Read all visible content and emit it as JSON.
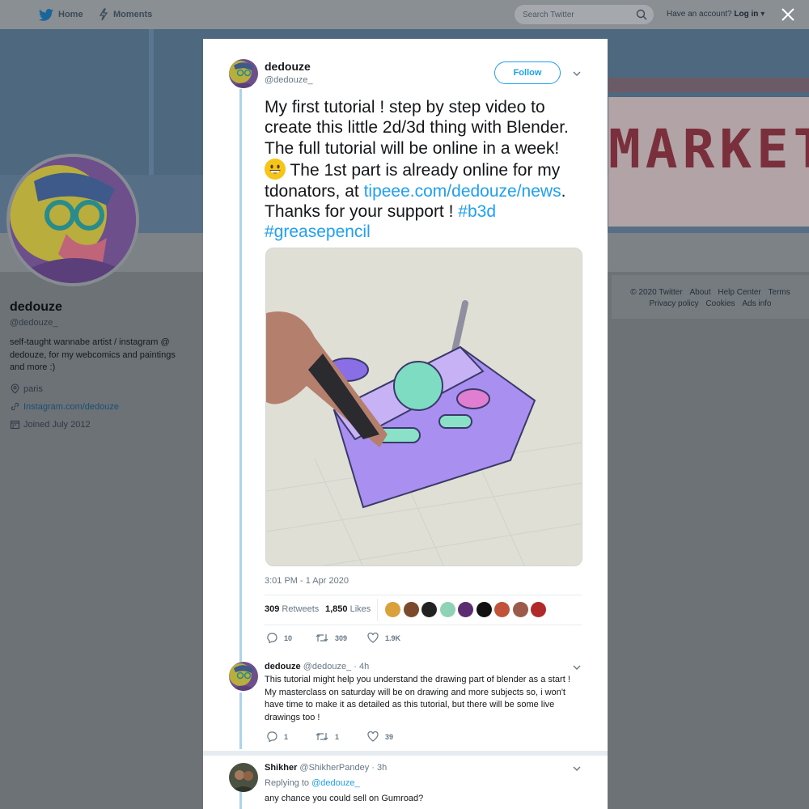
{
  "nav": {
    "home": "Home",
    "moments": "Moments",
    "search_placeholder": "Search Twitter",
    "have_account": "Have an account?",
    "login": "Log in"
  },
  "profile": {
    "name": "dedouze",
    "handle": "@dedouze_",
    "bio": "self-taught wannabe artist / instagram @ dedouze, for my webcomics and paintings and more :)",
    "location": "paris",
    "link": "Instagram.com/dedouze",
    "joined": "Joined July 2012"
  },
  "banner": {
    "sign_text": "MARKET"
  },
  "footer": {
    "copyright": "© 2020 Twitter",
    "links": [
      "About",
      "Help Center",
      "Terms",
      "Privacy policy",
      "Cookies",
      "Ads info"
    ]
  },
  "tweet": {
    "author_name": "dedouze",
    "author_handle": "@dedouze_",
    "follow_label": "Follow",
    "text_1": "My first tutorial ! step by step video to create this little 2d/3d thing with Blender. The full tutorial will be online in a week!",
    "text_2": " The 1st part is already online for my tdonators, at ",
    "link": "tipeee.com/dedouze/news",
    "text_3": ". Thanks for your support ! ",
    "hashtag_1": "#b3d",
    "hashtag_2": "#greasepencil",
    "timestamp": "3:01 PM - 1 Apr 2020",
    "retweets_count": "309",
    "retweets_label": "Retweets",
    "likes_count": "1,850",
    "likes_label": "Likes",
    "reply_count": "10",
    "retweet_count": "309",
    "like_count": "1.9K"
  },
  "likers": [
    "#d9a03b",
    "#7b4a2c",
    "#222222",
    "#8fd3b6",
    "#5b2c6f",
    "#111111",
    "#c0533a",
    "#9b5a4a",
    "#b02a2a"
  ],
  "replies": [
    {
      "name": "dedouze",
      "handle": "@dedouze_",
      "time": "· 4h",
      "text": "This tutorial might help you understand the drawing part of blender as a start ! My masterclass on saturday will be on drawing and more subjects so, i won't have time to make it as detailed as this tutorial, but there will be some live drawings too !",
      "reply_count": "1",
      "retweet_count": "1",
      "like_count": "39"
    },
    {
      "name": "Shikher",
      "handle": "@ShikherPandey",
      "time": "· 3h",
      "replying_label": "Replying to",
      "replying_handle": "@dedouze_",
      "text": "any chance you could sell on Gumroad?"
    }
  ],
  "colors": {
    "accent": "#1da1f2",
    "overlay": "#6d7277",
    "thread_line": "#a9d5ee"
  }
}
